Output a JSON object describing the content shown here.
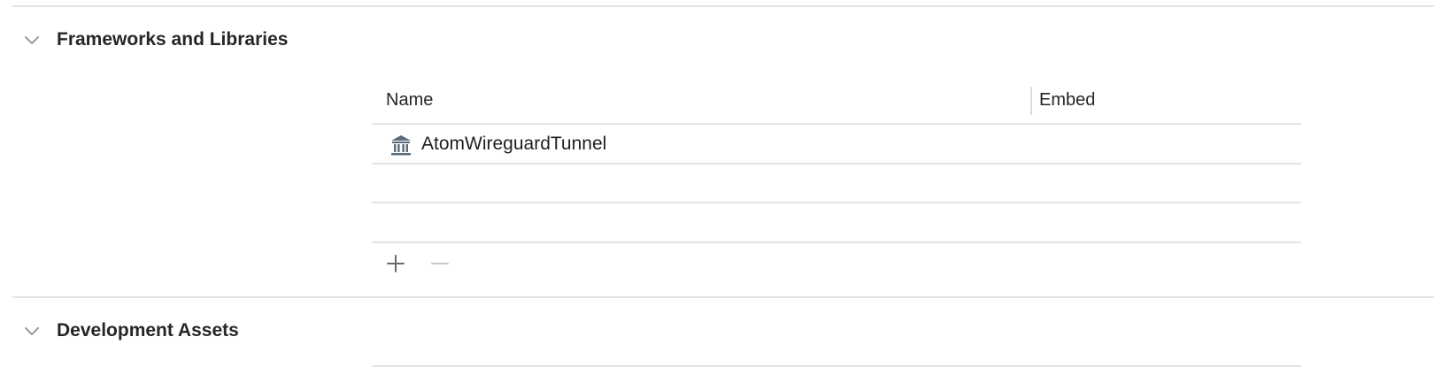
{
  "sections": {
    "frameworks": {
      "title": "Frameworks and Libraries",
      "expanded": true,
      "table": {
        "columns": [
          "Name",
          "Embed"
        ],
        "rows": [
          {
            "name": "AtomWireguardTunnel",
            "embed": "",
            "icon": "framework-icon"
          }
        ]
      },
      "toolbar": {
        "add_icon": "plus-icon",
        "remove_icon": "minus-icon"
      }
    },
    "development_assets": {
      "title": "Development Assets",
      "expanded": true
    }
  },
  "colors": {
    "separator": "#e3e3e3",
    "icon": "#5a6b7c",
    "disabled": "#c8c8c8"
  }
}
